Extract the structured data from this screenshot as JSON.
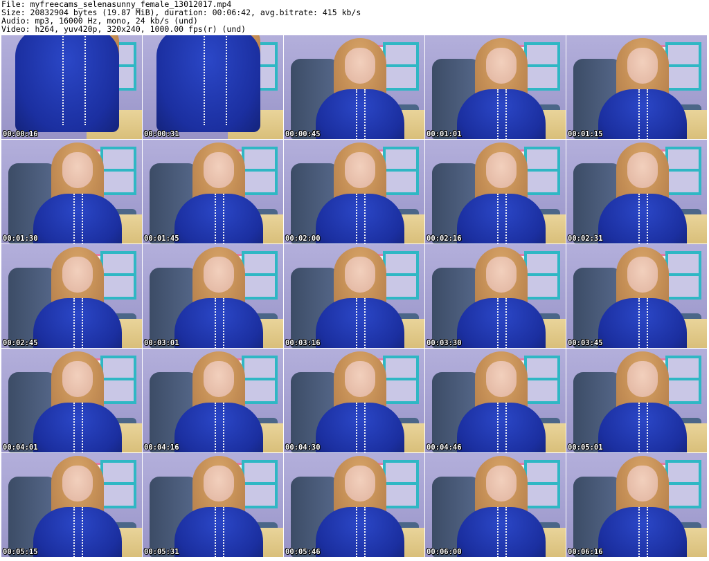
{
  "header": {
    "file_line": "File: myfreecams_selenasunny_female_13012017.mp4",
    "size_line": "Size: 20832904 bytes (19.87 MiB), duration: 00:06:42, avg.bitrate: 415 kb/s",
    "audio_line": "Audio: mp3, 16000 Hz, mono, 24 kb/s (und)",
    "video_line": "Video: h264, yuv420p, 320x240, 1000.00 fps(r) (und)"
  },
  "thumbnails": [
    {
      "timestamp": "00:00:16"
    },
    {
      "timestamp": "00:00:31"
    },
    {
      "timestamp": "00:00:45"
    },
    {
      "timestamp": "00:01:01"
    },
    {
      "timestamp": "00:01:15"
    },
    {
      "timestamp": "00:01:30"
    },
    {
      "timestamp": "00:01:45"
    },
    {
      "timestamp": "00:02:00"
    },
    {
      "timestamp": "00:02:16"
    },
    {
      "timestamp": "00:02:31"
    },
    {
      "timestamp": "00:02:45"
    },
    {
      "timestamp": "00:03:01"
    },
    {
      "timestamp": "00:03:16"
    },
    {
      "timestamp": "00:03:30"
    },
    {
      "timestamp": "00:03:45"
    },
    {
      "timestamp": "00:04:01"
    },
    {
      "timestamp": "00:04:16"
    },
    {
      "timestamp": "00:04:30"
    },
    {
      "timestamp": "00:04:46"
    },
    {
      "timestamp": "00:05:01"
    },
    {
      "timestamp": "00:05:15"
    },
    {
      "timestamp": "00:05:31"
    },
    {
      "timestamp": "00:05:46"
    },
    {
      "timestamp": "00:06:00"
    },
    {
      "timestamp": "00:06:16"
    }
  ]
}
